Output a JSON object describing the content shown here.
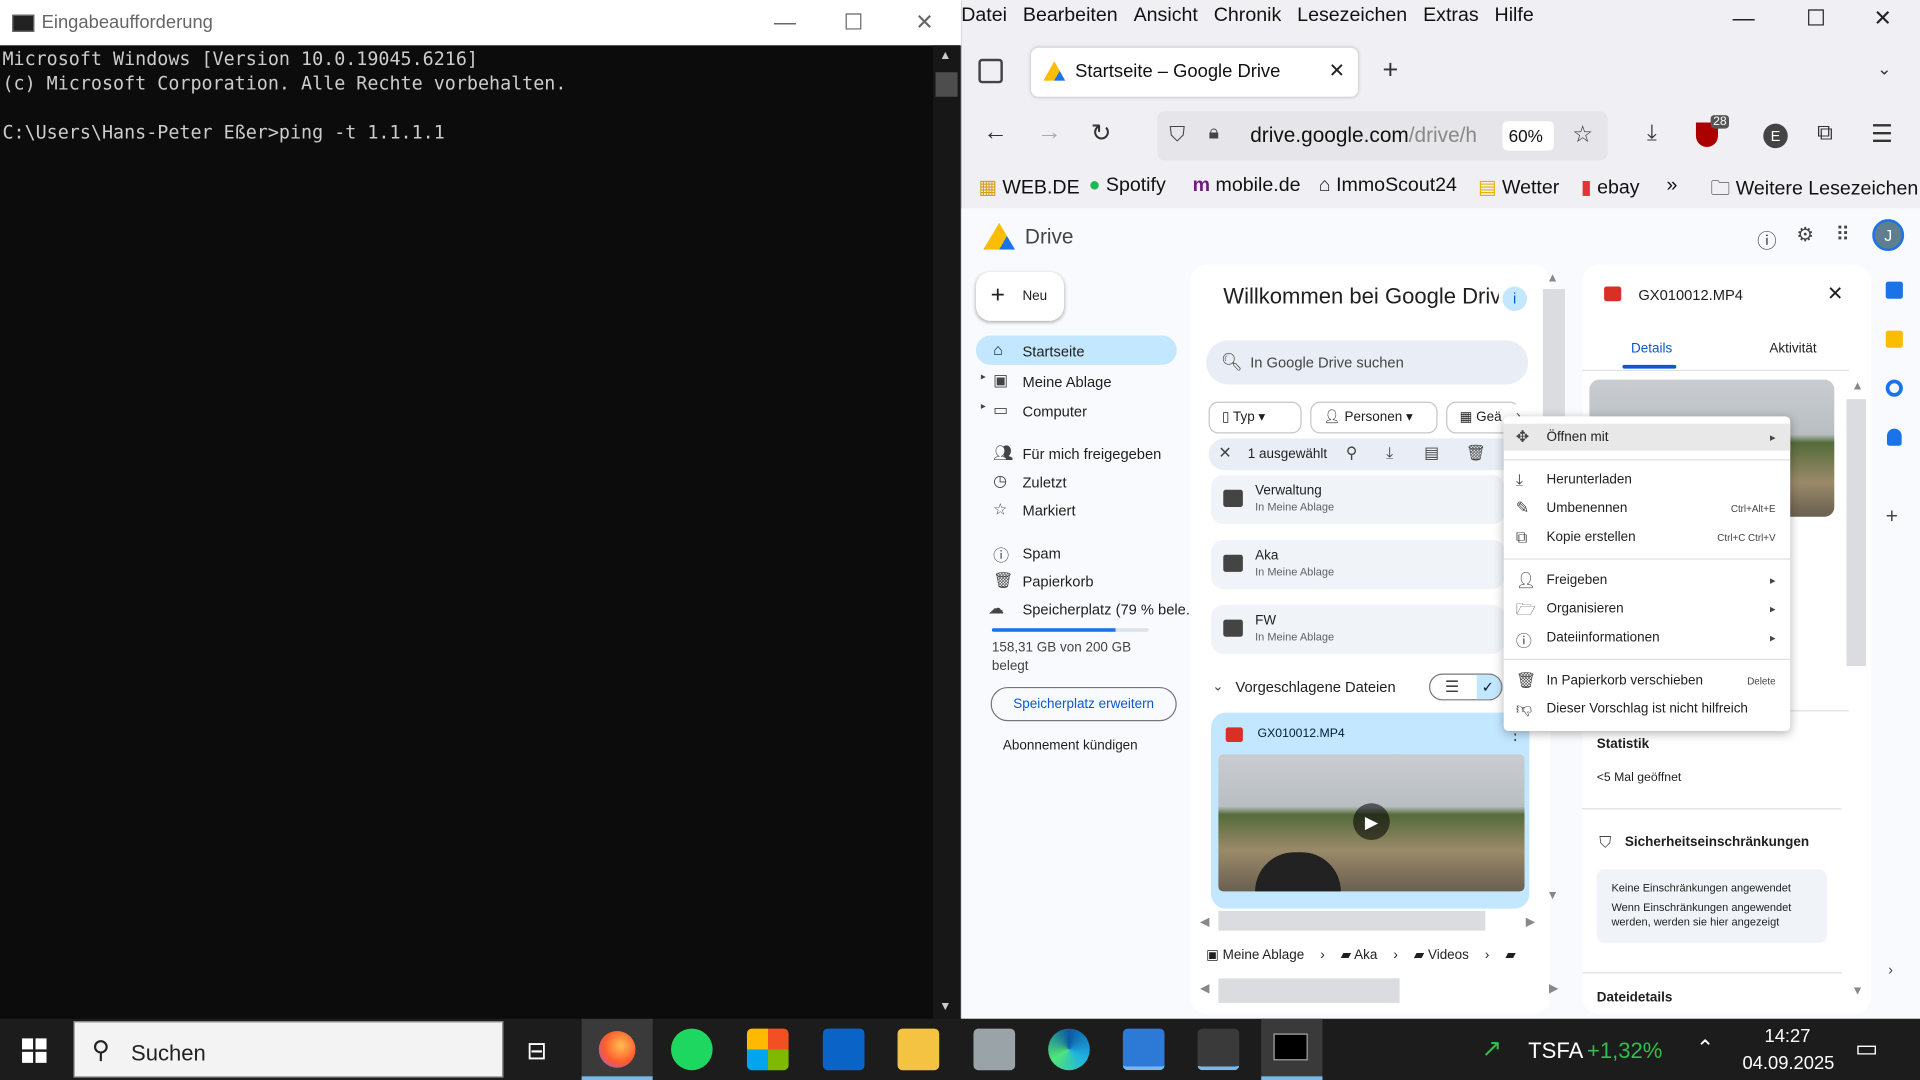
{
  "cmd": {
    "title": "Eingabeaufforderung",
    "lines": [
      "Microsoft Windows [Version 10.0.19045.6216]",
      "(c) Microsoft Corporation. Alle Rechte vorbehalten.",
      "",
      "C:\\Users\\Hans-Peter Eßer>ping -t 1.1.1.1"
    ]
  },
  "firefox": {
    "menu": [
      "Datei",
      "Bearbeiten",
      "Ansicht",
      "Chronik",
      "Lesezeichen",
      "Extras",
      "Hilfe"
    ],
    "tab_title": "Startseite – Google Drive",
    "url_host": "drive.google.com",
    "url_path": "/drive/h",
    "zoom": "60%",
    "badge_count": "28",
    "account_initial": "E",
    "bookmarks": [
      "WEB.DE",
      "Spotify",
      "mobile.de",
      "ImmoScout24",
      "Wetter",
      "ebay"
    ],
    "more_bookmarks": "Weitere Lesezeichen"
  },
  "drive": {
    "logo_text": "Drive",
    "user_initial": "J",
    "new_label": "Neu",
    "nav": {
      "home": "Startseite",
      "my_drive": "Meine Ablage",
      "computer": "Computer",
      "shared": "Für mich freigegeben",
      "recent": "Zuletzt",
      "starred": "Markiert",
      "spam": "Spam",
      "trash": "Papierkorb",
      "storage": "Speicherplatz (79 % bele..."
    },
    "storage_fraction": 0.79,
    "storage_text_1": "158,31 GB von 200 GB",
    "storage_text_2": "belegt",
    "upgrade_label": "Speicherplatz erweitern",
    "cancel_sub": "Abonnement kündigen",
    "welcome": "Willkommen bei Google Drive",
    "search_placeholder": "In Google Drive suchen",
    "chips": [
      "Typ",
      "Personen",
      "Geä"
    ],
    "selected_count": "1 ausgewählt",
    "folders": [
      {
        "name": "Verwaltung",
        "loc": "In Meine Ablage"
      },
      {
        "name": "Aka",
        "loc": "In Meine Ablage"
      },
      {
        "name": "FW",
        "loc": "In Meine Ablage"
      }
    ],
    "suggested_title": "Vorgeschlagene Dateien",
    "file_name": "GX010012.MP4",
    "breadcrumb": [
      "Meine Ablage",
      "Aka",
      "Videos"
    ],
    "details": {
      "file_name": "GX010012.MP4",
      "tab_details": "Details",
      "tab_activity": "Aktivität",
      "stats_title": "Statistik",
      "stats_value": "<5 Mal geöffnet",
      "security_title": "Sicherheitseinschränkungen",
      "security_box_title": "Keine Einschränkungen angewendet",
      "security_box_text_1": "Wenn Einschränkungen angewendet",
      "security_box_text_2": "werden, werden sie hier angezeigt",
      "file_details": "Dateidetails"
    }
  },
  "context_menu": {
    "open_with": "Öffnen mit",
    "download": "Herunterladen",
    "rename": "Umbenennen",
    "rename_sc": "Ctrl+Alt+E",
    "copy": "Kopie erstellen",
    "copy_sc": "Ctrl+C Ctrl+V",
    "share": "Freigeben",
    "organize": "Organisieren",
    "file_info": "Dateiinformationen",
    "trash": "In Papierkorb verschieben",
    "trash_sc": "Delete",
    "not_helpful": "Dieser Vorschlag ist nicht hilfreich"
  },
  "taskbar": {
    "search_placeholder": "Suchen",
    "stock_name": "TSFA",
    "stock_change": "+1,32%",
    "time": "14:27",
    "date": "04.09.2025"
  }
}
